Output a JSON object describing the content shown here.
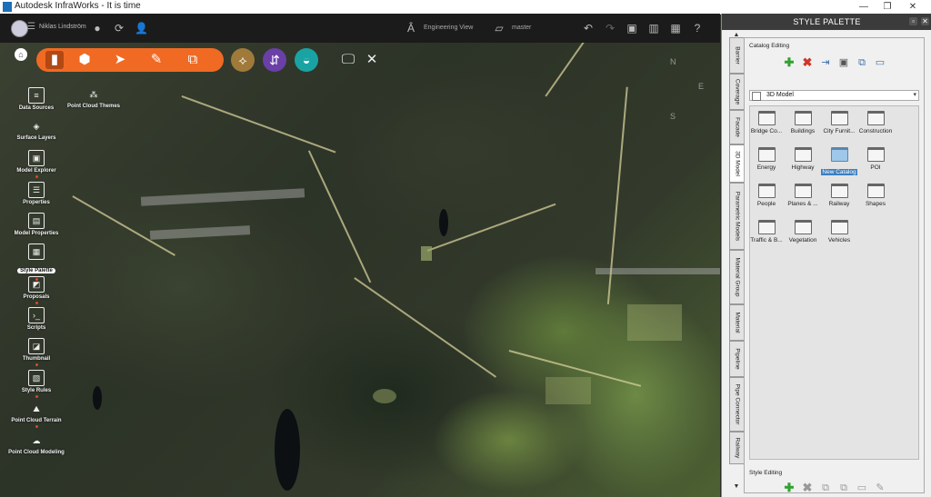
{
  "window": {
    "title": "Autodesk InfraWorks - It is time",
    "minimize": "—",
    "maximize": "❐",
    "close": "✕"
  },
  "topbar": {
    "user": "Niklas Lindström",
    "view_label": "Engineering View",
    "proposal_label": "master"
  },
  "left_panel": {
    "items": [
      {
        "label": "Data Sources"
      },
      {
        "label": "Point Cloud Themes"
      },
      {
        "label": "Surface Layers"
      },
      {
        "label": "Model Explorer"
      },
      {
        "label": "Properties"
      },
      {
        "label": "Model Properties"
      },
      {
        "label": "Style Palette"
      },
      {
        "label": "Proposals"
      },
      {
        "label": "Scripts"
      },
      {
        "label": "Thumbnail"
      },
      {
        "label": "Style Rules"
      },
      {
        "label": "Point Cloud Terrain"
      },
      {
        "label": "Point Cloud Modeling"
      }
    ],
    "selected": "Style Palette"
  },
  "compass": {
    "n": "N",
    "e": "E",
    "s": "S"
  },
  "style_palette": {
    "title": "STYLE PALETTE",
    "tabs": [
      "Barrier",
      "Coverage",
      "Facade",
      "3D Model",
      "Parametric Models",
      "Material Group",
      "Material",
      "Pipeline",
      "Pipe Connector",
      "Railway"
    ],
    "active_tab": "3D Model",
    "catalog_editing_label": "Catalog Editing",
    "style_editing_label": "Style Editing",
    "dropdown_value": "3D Model",
    "folders": [
      {
        "label": "Bridge Co..."
      },
      {
        "label": "Buildings"
      },
      {
        "label": "City Furnit..."
      },
      {
        "label": "Construction"
      },
      {
        "label": "Energy"
      },
      {
        "label": "Highway"
      },
      {
        "label": "New Catalog"
      },
      {
        "label": "POI"
      },
      {
        "label": "People"
      },
      {
        "label": "Planes & ..."
      },
      {
        "label": "Railway"
      },
      {
        "label": "Shapes"
      },
      {
        "label": "Traffic & B..."
      },
      {
        "label": "Vegetation"
      },
      {
        "label": "Vehicles"
      }
    ],
    "selected_folder": "New Catalog"
  },
  "colors": {
    "toolbar_orange": "#f06a24",
    "btn_tan": "#a07a3a",
    "btn_purple": "#6a3fa6",
    "btn_teal": "#1aa3a3",
    "add_green": "#2ea32e",
    "delete_red": "#d0342a",
    "selection_blue": "#3c7fc1"
  }
}
